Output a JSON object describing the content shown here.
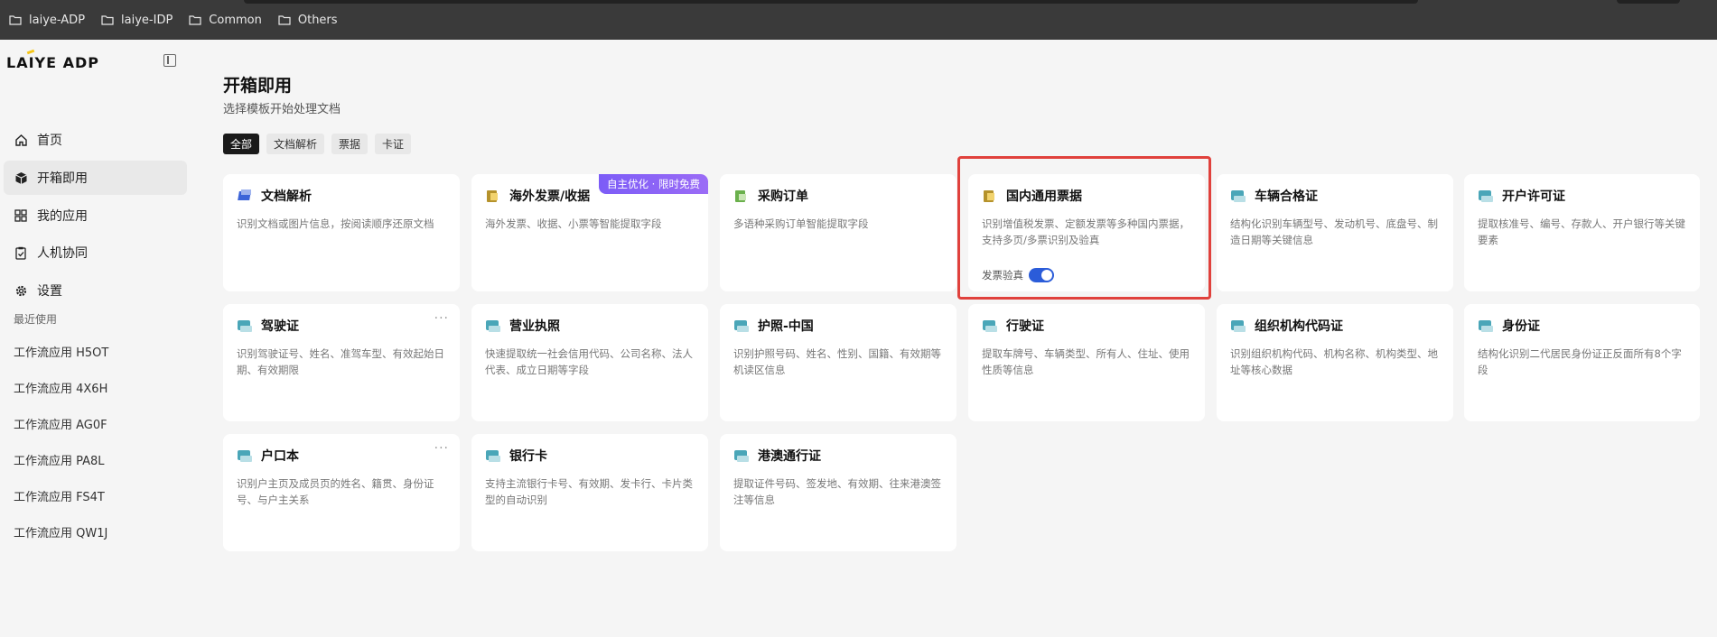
{
  "bookmarks": [
    "laiye-ADP",
    "laiye-IDP",
    "Common",
    "Others"
  ],
  "logo": {
    "text_pre": "LA",
    "text_i": "I",
    "text_post": "YE ADP"
  },
  "nav": [
    {
      "label": "首页",
      "icon": "home-icon"
    },
    {
      "label": "开箱即用",
      "icon": "cube-icon",
      "active": true
    },
    {
      "label": "我的应用",
      "icon": "grid-icon"
    },
    {
      "label": "人机协同",
      "icon": "clipboard-check-icon"
    },
    {
      "label": "设置",
      "icon": "gear-icon"
    }
  ],
  "recent": {
    "title": "最近使用",
    "items": [
      "工作流应用 H5OT",
      "工作流应用 4X6H",
      "工作流应用 AG0F",
      "工作流应用 PA8L",
      "工作流应用 FS4T",
      "工作流应用 QW1J"
    ]
  },
  "main": {
    "title": "开箱即用",
    "subtitle": "选择模板开始处理文档",
    "filters": [
      "全部",
      "文档解析",
      "票据",
      "卡证"
    ],
    "cards": [
      {
        "title": "文档解析",
        "desc": "识别文档或图片信息，按阅读顺序还原文档",
        "icon": "doc"
      },
      {
        "title": "海外发票/收据",
        "desc": "海外发票、收据、小票等智能提取字段",
        "icon": "gold",
        "badge": "自主优化 · 限时免费"
      },
      {
        "title": "采购订单",
        "desc": "多语种采购订单智能提取字段",
        "icon": "green"
      },
      {
        "title": "国内通用票据",
        "desc": "识别增值税发票、定额发票等多种国内票据，支持多页/多票识别及验真",
        "icon": "gold",
        "toggle_label": "发票验真",
        "toggle_on": true
      },
      {
        "title": "车辆合格证",
        "desc": "结构化识别车辆型号、发动机号、底盘号、制造日期等关键信息",
        "icon": "teal"
      },
      {
        "title": "开户许可证",
        "desc": "提取核准号、编号、存款人、开户银行等关键要素",
        "icon": "teal"
      },
      {
        "title": "驾驶证",
        "desc": "识别驾驶证号、姓名、准驾车型、有效起始日期、有效期限",
        "icon": "teal",
        "more": "···"
      },
      {
        "title": "营业执照",
        "desc": "快速提取统一社会信用代码、公司名称、法人代表、成立日期等字段",
        "icon": "teal"
      },
      {
        "title": "护照-中国",
        "desc": "识别护照号码、姓名、性别、国籍、有效期等机读区信息",
        "icon": "teal"
      },
      {
        "title": "行驶证",
        "desc": "提取车牌号、车辆类型、所有人、住址、使用性质等信息",
        "icon": "teal"
      },
      {
        "title": "组织机构代码证",
        "desc": "识别组织机构代码、机构名称、机构类型、地址等核心数据",
        "icon": "teal"
      },
      {
        "title": "身份证",
        "desc": "结构化识别二代居民身份证正反面所有8个字段",
        "icon": "teal"
      },
      {
        "title": "户口本",
        "desc": "识别户主页及成员页的姓名、籍贯、身份证号、与户主关系",
        "icon": "teal",
        "more": "···"
      },
      {
        "title": "银行卡",
        "desc": "支持主流银行卡号、有效期、发卡行、卡片类型的自动识别",
        "icon": "teal"
      },
      {
        "title": "港澳通行证",
        "desc": "提取证件号码、签发地、有效期、往来港澳签注等信息",
        "icon": "teal"
      }
    ]
  }
}
